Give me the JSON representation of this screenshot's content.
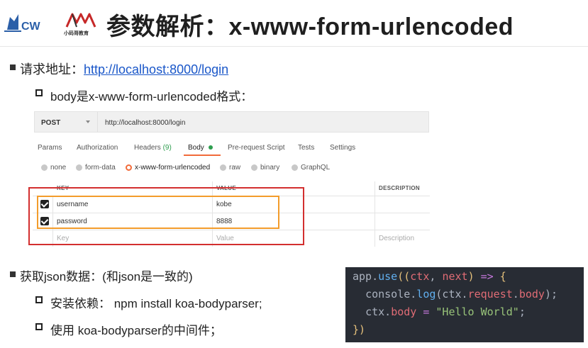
{
  "header": {
    "brand_name": "codewhy",
    "brand_cn": "小码哥教育",
    "title": "参数解析：x-www-form-urlencoded"
  },
  "bullets": {
    "request_label": "请求地址：",
    "request_url": "http://localhost:8000/login",
    "body_format": "body是x-www-form-urlencoded格式：",
    "get_json": "获取json数据：(和json是一致的)",
    "install_dep": "安装依赖： npm install koa-bodyparser;",
    "use_middleware": "使用 koa-bodyparser的中间件；"
  },
  "postman": {
    "method": "POST",
    "url": "http://localhost:8000/login",
    "tabs": [
      {
        "label": "Params"
      },
      {
        "label": "Authorization"
      },
      {
        "label": "Headers",
        "count": "(9)"
      },
      {
        "label": "Body"
      },
      {
        "label": "Pre-request Script"
      },
      {
        "label": "Tests"
      },
      {
        "label": "Settings"
      }
    ],
    "body_types": [
      "none",
      "form-data",
      "x-www-form-urlencoded",
      "raw",
      "binary",
      "GraphQL"
    ],
    "selected_body_type": "x-www-form-urlencoded",
    "columns": {
      "key": "KEY",
      "value": "VALUE",
      "description": "DESCRIPTION"
    },
    "rows": [
      {
        "key": "username",
        "value": "kobe",
        "checked": true
      },
      {
        "key": "password",
        "value": "8888",
        "checked": true
      }
    ],
    "placeholder": {
      "key": "Key",
      "value": "Value",
      "description": "Description"
    }
  },
  "code": {
    "line1_a": "app",
    "line1_b": ".",
    "line1_c": "use",
    "line1_d": "((",
    "line1_e": "ctx",
    "line1_f": ", ",
    "line1_g": "next",
    "line1_h": ") ",
    "line1_i": "=>",
    "line1_j": " {",
    "line2_a": "console",
    "line2_b": ".",
    "line2_c": "log",
    "line2_d": "(ctx.",
    "line2_e": "request",
    "line2_f": ".",
    "line2_g": "body",
    "line2_h": ");",
    "line3_a": "ctx",
    "line3_b": ".",
    "line3_c": "body",
    "line3_d": " = ",
    "line3_e": "\"Hello World\"",
    "line3_f": ";",
    "line4_a": "})",
    "colors": {
      "background": "#282c34",
      "function": "#61afef",
      "property": "#e06c75",
      "string": "#98c379"
    }
  }
}
